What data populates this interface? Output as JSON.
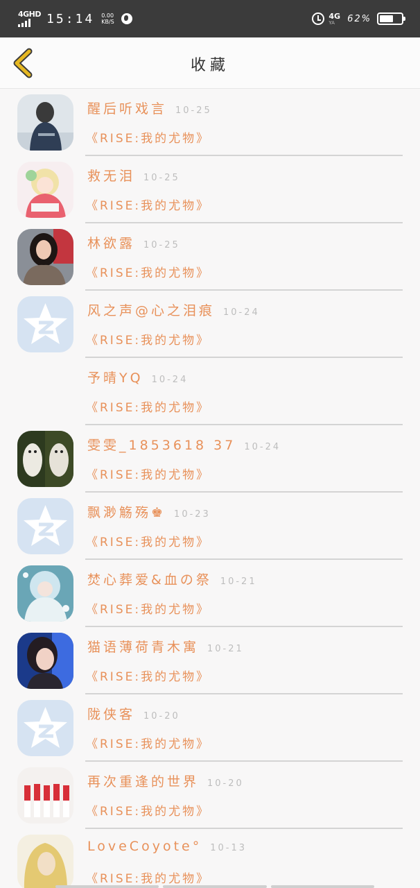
{
  "status_bar": {
    "network_label": "4GHD",
    "time": "15:14",
    "speed_value": "0.00",
    "speed_unit": "KB/S",
    "network_right": "4G",
    "network_right_sub": "YA",
    "battery_text": "62%",
    "battery_level": 0.62
  },
  "header": {
    "title": "收藏",
    "back_icon": "chevron-left-icon"
  },
  "colors": {
    "accent": "#e8915a",
    "back_arrow": "#e6b822",
    "date": "#bdbdbd",
    "divider": "#d4d4d4"
  },
  "favorites": [
    {
      "name": "醒后听戏言",
      "date": "10-25",
      "title": "《RISE:我的尤物》",
      "avatar": "photo-girl-back-icon"
    },
    {
      "name": "救无泪",
      "date": "10-25",
      "title": "《RISE:我的尤物》",
      "avatar": "anime-girl-icon"
    },
    {
      "name": "林欲露",
      "date": "10-25",
      "title": "《RISE:我的尤物》",
      "avatar": "photo-woman-icon"
    },
    {
      "name": "风之声@心之泪痕",
      "date": "10-24",
      "title": "《RISE:我的尤物》",
      "avatar": "qzone-star-icon"
    },
    {
      "name": "予晴YQ",
      "date": "10-24",
      "title": "《RISE:我的尤物》",
      "avatar": "none"
    },
    {
      "name": "雯雯_1853618 37",
      "date": "10-24",
      "title": "《RISE:我的尤物》",
      "avatar": "photo-dogs-icon"
    },
    {
      "name": "飘渺觞殇♚",
      "date": "10-23",
      "title": "《RISE:我的尤物》",
      "avatar": "qzone-star-icon"
    },
    {
      "name": "焚心葬爱&血の祭",
      "date": "10-21",
      "title": "《RISE:我的尤物》",
      "avatar": "anime-blue-girl-icon"
    },
    {
      "name": "猫语薄荷青木寓",
      "date": "10-21",
      "title": "《RISE:我的尤物》",
      "avatar": "photo-girl-icon"
    },
    {
      "name": "陇侠客",
      "date": "10-20",
      "title": "《RISE:我的尤物》",
      "avatar": "qzone-star-icon"
    },
    {
      "name": "再次重逢的世界",
      "date": "10-20",
      "title": "《RISE:我的尤物》",
      "avatar": "photo-group-icon"
    },
    {
      "name": "LoveCoyote°",
      "date": "10-13",
      "title": "《RISE:我的尤物》",
      "avatar": "photo-blonde-icon"
    }
  ]
}
